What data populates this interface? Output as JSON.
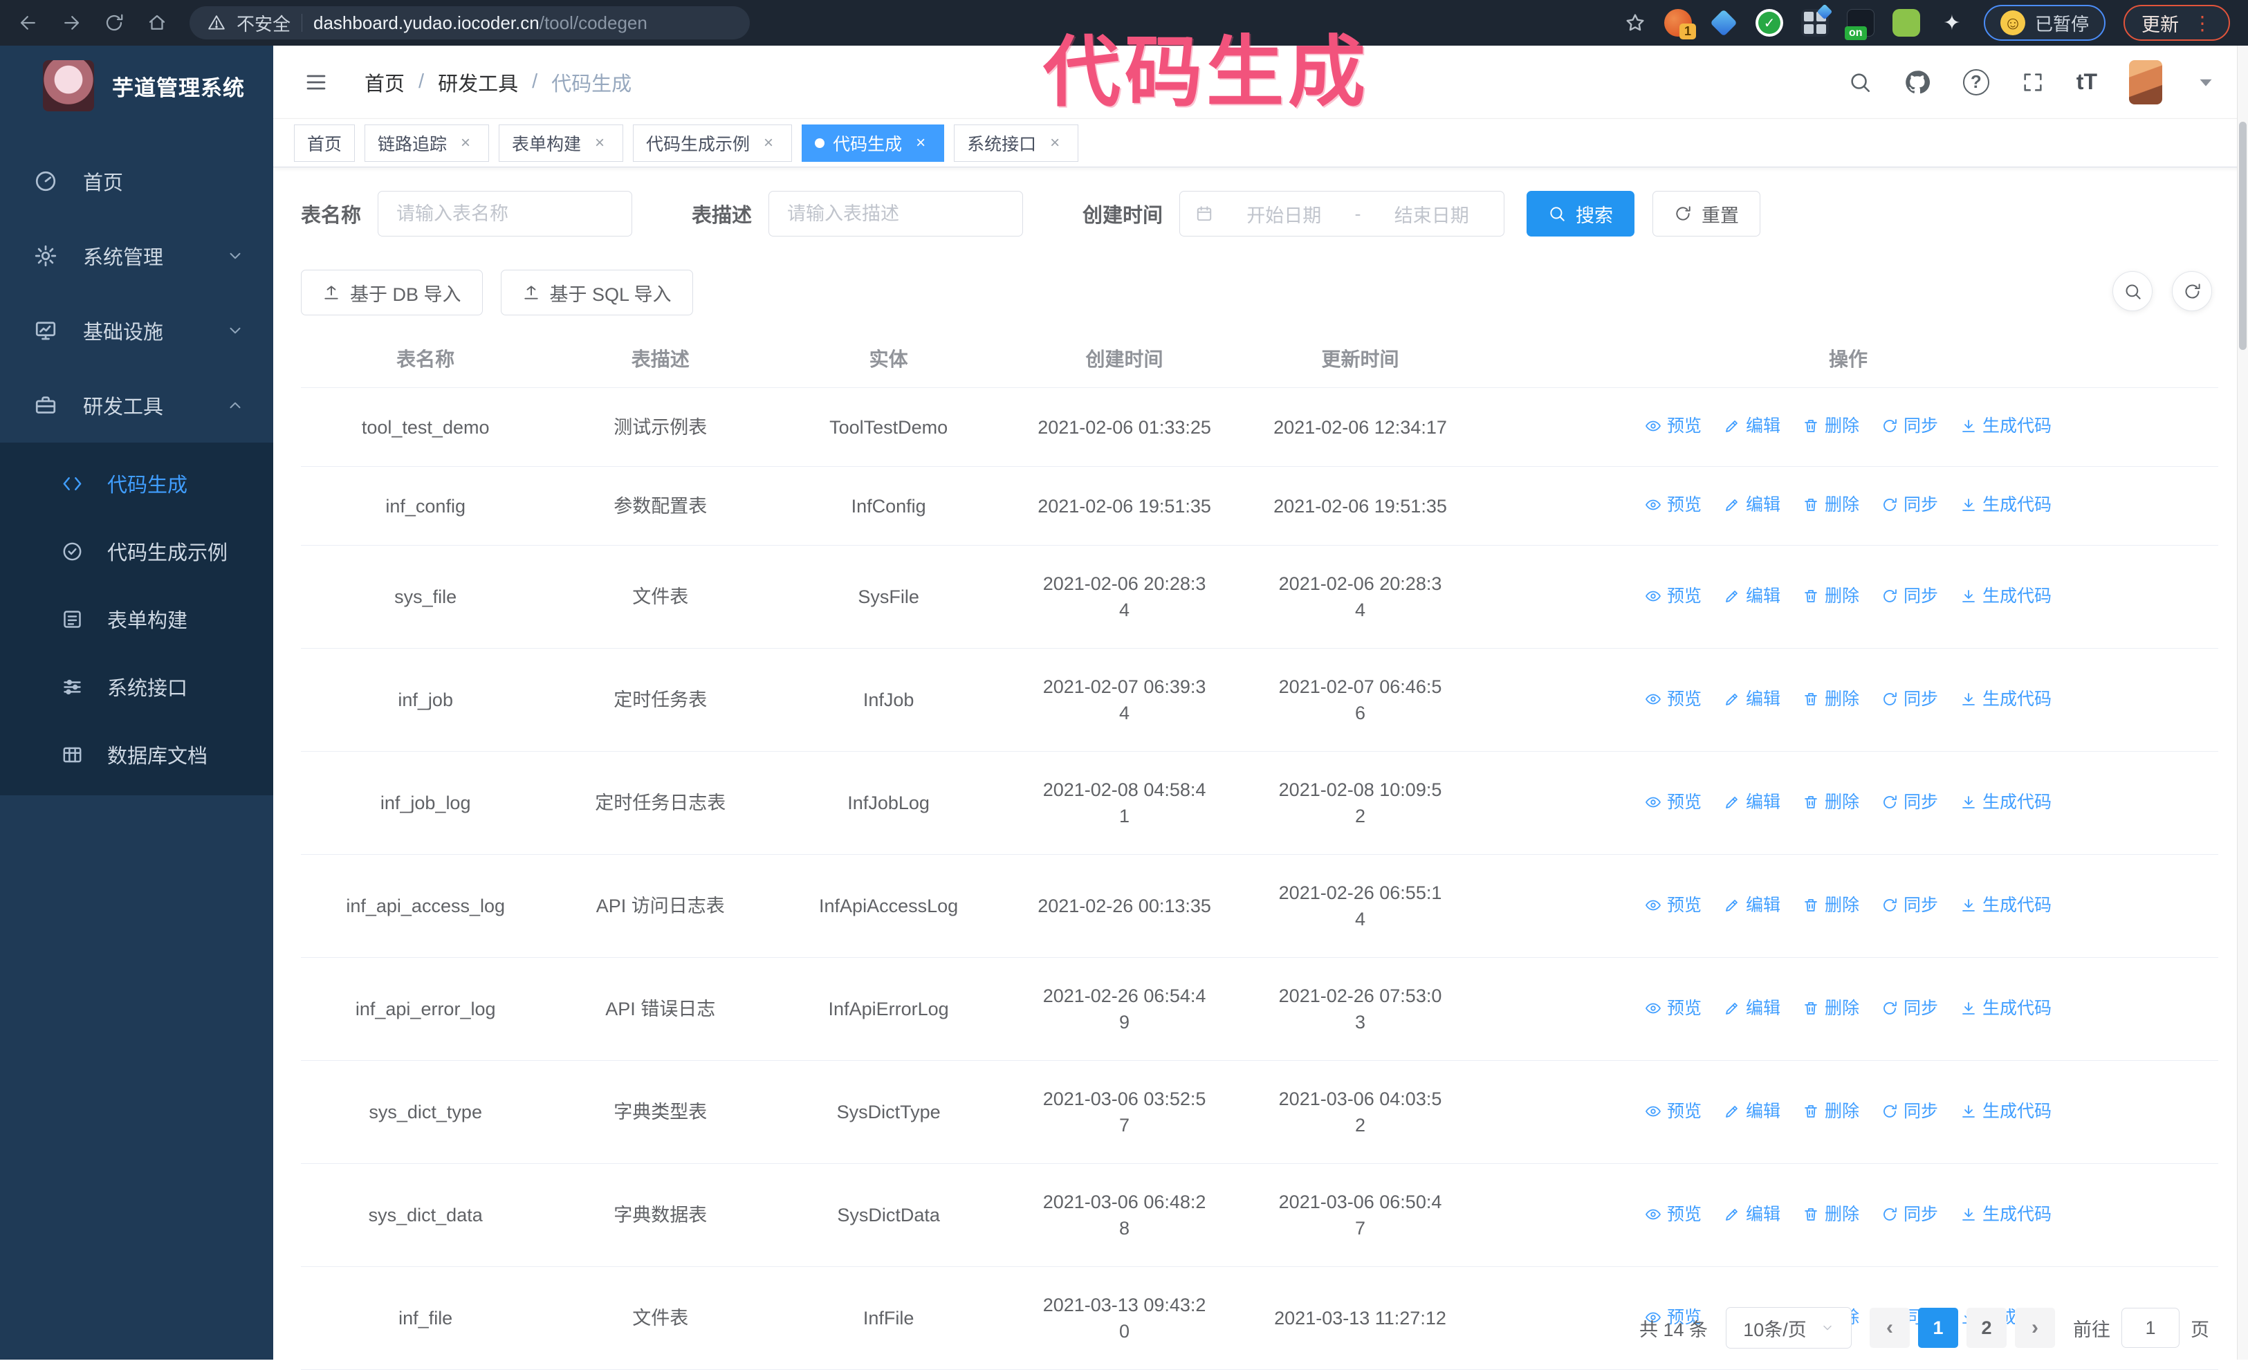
{
  "colors": {
    "accent": "#409eff",
    "primary_button": "#2395f1",
    "overlay_pink": "#f2537c",
    "sidebar_bg": "#1f3a56",
    "submenu_bg": "#152c42",
    "chrome_bg": "#1d2632"
  },
  "browser": {
    "security_label": "不安全",
    "url_host": "dashboard.yudao.iocoder.cn",
    "url_path": "/tool/codegen",
    "ext_badge": "1",
    "ext_on_label": "on",
    "paused_label": "已暂停",
    "update_label": "更新"
  },
  "overlay": {
    "text": "代码生成"
  },
  "sidebar": {
    "title": "芋道管理系统",
    "menu": [
      {
        "key": "home",
        "label": "首页",
        "icon": "dashboard-icon",
        "chevron": null
      },
      {
        "key": "system",
        "label": "系统管理",
        "icon": "gear-icon",
        "chevron": "down"
      },
      {
        "key": "infra",
        "label": "基础设施",
        "icon": "monitor-icon",
        "chevron": "down"
      },
      {
        "key": "devtools",
        "label": "研发工具",
        "icon": "toolbox-icon",
        "chevron": "up"
      }
    ],
    "submenu": [
      {
        "key": "codegen",
        "label": "代码生成",
        "icon": "code-icon",
        "active": true
      },
      {
        "key": "codegen-example",
        "label": "代码生成示例",
        "icon": "badge-check-icon",
        "active": false
      },
      {
        "key": "form-builder",
        "label": "表单构建",
        "icon": "form-icon",
        "active": false
      },
      {
        "key": "system-api",
        "label": "系统接口",
        "icon": "sliders-icon",
        "active": false
      },
      {
        "key": "db-doc",
        "label": "数据库文档",
        "icon": "table-grid-icon",
        "active": false
      }
    ]
  },
  "navbar": {
    "breadcrumb": [
      "首页",
      "研发工具",
      "代码生成"
    ]
  },
  "tabs": [
    {
      "key": "home",
      "label": "首页",
      "closable": false,
      "active": false
    },
    {
      "key": "tracing",
      "label": "链路追踪",
      "closable": true,
      "active": false
    },
    {
      "key": "form-builder",
      "label": "表单构建",
      "closable": true,
      "active": false
    },
    {
      "key": "codegen-example",
      "label": "代码生成示例",
      "closable": true,
      "active": false
    },
    {
      "key": "codegen",
      "label": "代码生成",
      "closable": true,
      "active": true
    },
    {
      "key": "system-api",
      "label": "系统接口",
      "closable": true,
      "active": false
    }
  ],
  "filters": {
    "name_label": "表名称",
    "name_placeholder": "请输入表名称",
    "desc_label": "表描述",
    "desc_placeholder": "请输入表描述",
    "time_label": "创建时间",
    "start_placeholder": "开始日期",
    "range_separator": "-",
    "end_placeholder": "结束日期",
    "search_label": "搜索",
    "reset_label": "重置"
  },
  "toolbar": {
    "import_db_label": "基于 DB 导入",
    "import_sql_label": "基于 SQL 导入"
  },
  "table": {
    "columns": [
      "表名称",
      "表描述",
      "实体",
      "创建时间",
      "更新时间",
      "操作"
    ],
    "ops": [
      {
        "key": "preview",
        "label": "预览",
        "icon": "eye-icon"
      },
      {
        "key": "edit",
        "label": "编辑",
        "icon": "edit-icon"
      },
      {
        "key": "delete",
        "label": "删除",
        "icon": "delete-icon"
      },
      {
        "key": "sync",
        "label": "同步",
        "icon": "sync-icon"
      },
      {
        "key": "generate",
        "label": "生成代码",
        "icon": "download-icon"
      }
    ],
    "rows": [
      {
        "name": "tool_test_demo",
        "desc": "测试示例表",
        "entity": "ToolTestDemo",
        "created": "2021-02-06 01:33:25",
        "updated": "2021-02-06 12:34:17"
      },
      {
        "name": "inf_config",
        "desc": "参数配置表",
        "entity": "InfConfig",
        "created": "2021-02-06 19:51:35",
        "updated": "2021-02-06 19:51:35"
      },
      {
        "name": "sys_file",
        "desc": "文件表",
        "entity": "SysFile",
        "created": "2021-02-06 20:28:3\n4",
        "updated": "2021-02-06 20:28:3\n4"
      },
      {
        "name": "inf_job",
        "desc": "定时任务表",
        "entity": "InfJob",
        "created": "2021-02-07 06:39:3\n4",
        "updated": "2021-02-07 06:46:5\n6"
      },
      {
        "name": "inf_job_log",
        "desc": "定时任务日志表",
        "entity": "InfJobLog",
        "created": "2021-02-08 04:58:4\n1",
        "updated": "2021-02-08 10:09:5\n2"
      },
      {
        "name": "inf_api_access_log",
        "desc": "API 访问日志表",
        "entity": "InfApiAccessLog",
        "created": "2021-02-26 00:13:35",
        "updated": "2021-02-26 06:55:1\n4"
      },
      {
        "name": "inf_api_error_log",
        "desc": "API 错误日志",
        "entity": "InfApiErrorLog",
        "created": "2021-02-26 06:54:4\n9",
        "updated": "2021-02-26 07:53:0\n3"
      },
      {
        "name": "sys_dict_type",
        "desc": "字典类型表",
        "entity": "SysDictType",
        "created": "2021-03-06 03:52:5\n7",
        "updated": "2021-03-06 04:03:5\n2"
      },
      {
        "name": "sys_dict_data",
        "desc": "字典数据表",
        "entity": "SysDictData",
        "created": "2021-03-06 06:48:2\n8",
        "updated": "2021-03-06 06:50:4\n7"
      },
      {
        "name": "inf_file",
        "desc": "文件表",
        "entity": "InfFile",
        "created": "2021-03-13 09:43:2\n0",
        "updated": "2021-03-13 11:27:12"
      }
    ]
  },
  "pagination": {
    "total": "共 14 条",
    "page_size": "10条/页",
    "pages": [
      "1",
      "2"
    ],
    "active_page": "1",
    "goto_label": "前往",
    "goto_value": "1",
    "page_unit": "页"
  }
}
